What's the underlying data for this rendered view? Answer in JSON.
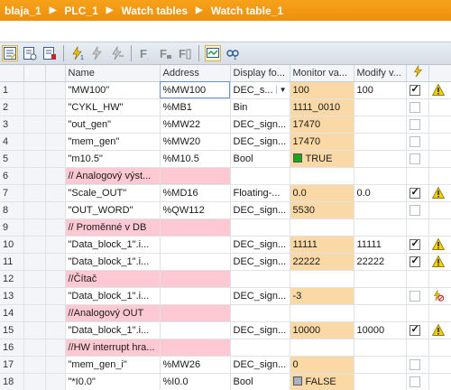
{
  "breadcrumb": [
    {
      "label": "blaja_1"
    },
    {
      "label": "PLC_1"
    },
    {
      "label": "Watch tables"
    },
    {
      "label": "Watch table_1"
    }
  ],
  "breadcrumb_separator": "▶",
  "toolbar_icons": [
    "select-column-icon",
    "show-all-modify-icon",
    "insert-row-icon",
    "modify-now-icon",
    "modify-once-icon",
    "modify-trigger-icon",
    "force-icon",
    "force-all-icon",
    "stop-force-icon",
    "monitor-all-icon",
    "monitor-once-icon"
  ],
  "columns": {
    "index": "i",
    "name": "Name",
    "address": "Address",
    "display_format": "Display fo...",
    "monitor_value": "Monitor va...",
    "modify_value": "Modify v..."
  },
  "colors": {
    "title_bar": "#f39c12",
    "monitor_cell": "#fbd9a6",
    "comment_cell": "#ffc9d3",
    "bool_true": "#18a518",
    "bool_false": "#a7b3c4",
    "warning": "#f2cf00"
  },
  "rows": [
    {
      "num": "1",
      "name": "\"MW100\"",
      "address": "%MW100",
      "format": "DEC_s...",
      "monitor": "100",
      "modify": "100",
      "checked": true,
      "icon": "warning-icon"
    },
    {
      "num": "2",
      "name": "\"CYKL_HW\"",
      "address": "%MB1",
      "format": "Bin",
      "monitor": "1111_0010",
      "modify": "",
      "checked": false,
      "icon": ""
    },
    {
      "num": "3",
      "name": "\"out_gen\"",
      "address": "%MW22",
      "format": "DEC_sign...",
      "monitor": "17470",
      "modify": "",
      "checked": false,
      "icon": ""
    },
    {
      "num": "4",
      "name": "\"mem_gen\"",
      "address": "%MW20",
      "format": "DEC_sign...",
      "monitor": "17470",
      "modify": "",
      "checked": false,
      "icon": ""
    },
    {
      "num": "5",
      "name": "\"m10.5\"",
      "address": "%M10.5",
      "format": "Bool",
      "monitor": "TRUE",
      "monitor_bool": "true",
      "modify": "",
      "checked": false,
      "icon": ""
    },
    {
      "num": "6",
      "comment": "// Analogový výst..."
    },
    {
      "num": "7",
      "name": "\"Scale_OUT\"",
      "address": "%MD16",
      "format": "Floating-...",
      "monitor": "0.0",
      "modify": "0.0",
      "checked": true,
      "icon": "warning-icon"
    },
    {
      "num": "8",
      "name": "\"OUT_WORD\"",
      "address": "%QW112",
      "format": "DEC_sign...",
      "monitor": "5530",
      "modify": "",
      "checked": false,
      "icon": ""
    },
    {
      "num": "9",
      "comment": "// Proměnné v DB"
    },
    {
      "num": "10",
      "name": "\"Data_block_1\".i...",
      "address": "",
      "format": "DEC_sign...",
      "monitor": "11111",
      "modify": "11111",
      "checked": true,
      "icon": "warning-icon"
    },
    {
      "num": "11",
      "name": "\"Data_block_1\".i...",
      "address": "",
      "format": "DEC_sign...",
      "monitor": "22222",
      "modify": "22222",
      "checked": true,
      "icon": "warning-icon"
    },
    {
      "num": "12",
      "comment": "//Čítač"
    },
    {
      "num": "13",
      "name": "\"Data_block_1\".i...",
      "address": "",
      "format": "DEC_sign...",
      "monitor": "-3",
      "modify": "",
      "checked": false,
      "icon": "force-blocked-icon"
    },
    {
      "num": "14",
      "comment": "//Analogový OUT"
    },
    {
      "num": "15",
      "name": "\"Data_block_1\".i...",
      "address": "",
      "format": "DEC_sign...",
      "monitor": "10000",
      "modify": "10000",
      "checked": true,
      "icon": "warning-icon"
    },
    {
      "num": "16",
      "comment": "//HW interrupt hra..."
    },
    {
      "num": "17",
      "name": "\"mem_gen_i\"",
      "address": "%MW26",
      "format": "DEC_sign...",
      "monitor": "0",
      "modify": "",
      "checked": false,
      "icon": ""
    },
    {
      "num": "18",
      "name": "\"*I0.0\"",
      "address": "%I0.0",
      "format": "Bool",
      "monitor": "FALSE",
      "monitor_bool": "false",
      "modify": "",
      "checked": false,
      "icon": ""
    }
  ]
}
